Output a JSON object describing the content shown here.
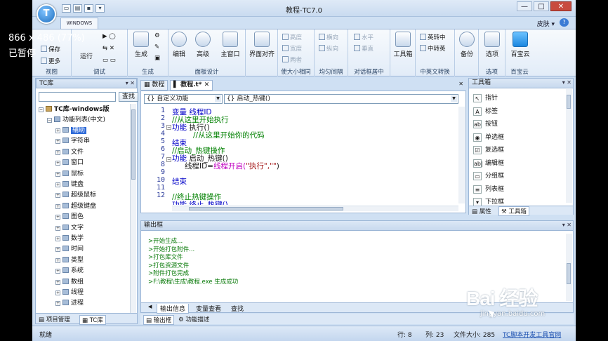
{
  "app": {
    "title": "教程-TC7.0",
    "logo_text": "T",
    "tab_windows": "WINDOWS",
    "skin": "皮肤 ▾",
    "help": "?",
    "window_controls": [
      "—",
      "□",
      "✕"
    ]
  },
  "ribbon": {
    "view": {
      "label": "视图",
      "save": "保存",
      "more": "更多"
    },
    "debug": {
      "label": "调试",
      "run": "运行"
    },
    "build": {
      "label": "生成",
      "build": "生成"
    },
    "panel_design": {
      "label": "面板设计",
      "edit": "编辑",
      "advanced": "高级",
      "main_window": "主窗口"
    },
    "alignment": {
      "align": "界面对齐"
    },
    "same_size": {
      "label": "使大小相同",
      "height": "高度",
      "width": "宽度",
      "both": "两者"
    },
    "equal_spacing": {
      "label": "均匀间隔",
      "horizontal": "横向",
      "vertical": "纵向"
    },
    "center": {
      "label": "对话框居中",
      "horizontal": "水平",
      "vertical": "垂直"
    },
    "tools": {
      "toolbox": "工具箱"
    },
    "conversion": {
      "label": "中英文转换",
      "to_chinese": "英转中",
      "to_english": "中转英"
    },
    "backup": {
      "backup": "备份"
    },
    "options": {
      "label": "选项",
      "options": "选项"
    },
    "baidu_cloud": {
      "label": "百宝云",
      "cloud": "百宝云"
    }
  },
  "tc_lib": {
    "title": "TC库",
    "search_button": "查找",
    "search_value": "",
    "root": "TC库-windows版",
    "func_list": "功能列表(中文)",
    "items": [
      "辅助",
      "字符串",
      "文件",
      "窗口",
      "鼠标",
      "键盘",
      "超级鼠标",
      "超级键盘",
      "图色",
      "文字",
      "数学",
      "时间",
      "类型",
      "系统",
      "数组",
      "线程",
      "进程"
    ],
    "selected_index": 0,
    "footer_project": "项目管理",
    "footer_tc": "TC库"
  },
  "editor": {
    "tabs": [
      {
        "label": "教程",
        "active": false
      },
      {
        "label": "教程.t*",
        "active": true
      }
    ],
    "combo_left": "{} 自定义功能",
    "combo_right": "{} 启动_热键()",
    "line_numbers": [
      "1",
      "2",
      "3",
      "4",
      "5",
      "6",
      "7",
      "8",
      "9",
      "10",
      "11",
      "12"
    ],
    "code": {
      "l1": "变量 线程ID",
      "l2": "//从这里开始执行",
      "l3a": "功能 ",
      "l3b": "执行()",
      "l4": "//从这里开始你的代码",
      "l5": "结束",
      "l6": "//启动_热键操作",
      "l7a": "功能 ",
      "l7b": "启动_热键()",
      "l8a": "线程ID=",
      "l8b": "线程开启(",
      "l8c": "\"执行\",\"\"",
      "l8d": ")",
      "l10": "结束",
      "l12": "//终止热键操作",
      "l13": "功能 终止_热键()"
    }
  },
  "toolbox": {
    "title": "工具箱",
    "items": [
      {
        "icon": "↖",
        "label": "指针"
      },
      {
        "icon": "A",
        "label": "标签"
      },
      {
        "icon": "ab",
        "label": "按钮"
      },
      {
        "icon": "◉",
        "label": "单选框"
      },
      {
        "icon": "☑",
        "label": "复选框"
      },
      {
        "icon": "ab|",
        "label": "编辑框"
      },
      {
        "icon": "▭",
        "label": "分组框"
      },
      {
        "icon": "≡",
        "label": "列表框"
      },
      {
        "icon": "▾",
        "label": "下拉框"
      }
    ],
    "footer_props": "属性",
    "footer_toolbox": "工具箱"
  },
  "output": {
    "title": "输出框",
    "lines": [
      ">开始生成...",
      ">开始打包附件...",
      ">打包库文件",
      ">打包资源文件",
      ">附件打包完成",
      ">F:\\教程\\生成\\教程.exe 生成成功"
    ],
    "tabs": [
      "输出信息",
      "变量查看",
      "查找"
    ],
    "bottom_tabs": [
      "输出框",
      "功能描述"
    ]
  },
  "status": {
    "ready": "就绪",
    "row": "行: 8",
    "col": "列: 23",
    "file_size": "文件大小: 285",
    "link": "TC脚本开发工具官网"
  },
  "overlay": {
    "resolution": "866 x 486 (77%)",
    "paused": "已暂停"
  },
  "watermark": {
    "brand": "Bai 经验",
    "url": "jingyan.baidu.com"
  },
  "colors": {
    "keyword": "#0000c8",
    "comment": "#008000",
    "string": "#a31515",
    "function": "#c000c0",
    "selection": "#2f6bd8",
    "output_text": "#0a7a0a"
  }
}
